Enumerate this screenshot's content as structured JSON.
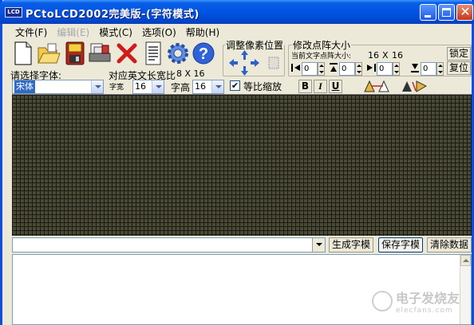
{
  "window": {
    "title": "PCtoLCD2002完美版-(字符模式)",
    "icon_text": "LCD"
  },
  "menu": [
    {
      "label": "文件(F)",
      "enabled": true
    },
    {
      "label": "编辑(E)",
      "enabled": false
    },
    {
      "label": "模式(C)",
      "enabled": true
    },
    {
      "label": "选项(O)",
      "enabled": true
    },
    {
      "label": "帮助(H)",
      "enabled": true
    }
  ],
  "toolbar": {
    "icons": [
      "new-icon",
      "open-icon",
      "save-icon",
      "print-icon",
      "delete-icon",
      "document-icon",
      "settings-gear-icon",
      "help-icon"
    ]
  },
  "adjust_group": {
    "title": "调整像素位置"
  },
  "resize_group": {
    "title": "修改点阵大小",
    "current_size_label": "当前文字点阵大小:",
    "width": "16",
    "x": "X",
    "height": "16",
    "lock_button": "锁定",
    "restore_button": "复位",
    "spinners": [
      "0",
      "0",
      "0",
      "0"
    ]
  },
  "font_row": {
    "choose_font_label": "请选择字体:",
    "font_value": "宋体",
    "ratio_label": "对应英文长宽比",
    "ratio_value": "8 X 16",
    "width_label": "字宽",
    "width_value": "16",
    "height_label": "字高",
    "height_value": "16",
    "proportional_label": "等比缩放",
    "proportional_checked": true,
    "bold": "B",
    "italic": "I",
    "underline": "U"
  },
  "actions": {
    "generate": "生成字模",
    "save": "保存字模",
    "clear": "清除数据"
  },
  "watermark": {
    "text": "电子发烧友",
    "sub": "elecfans.com"
  },
  "colors": {
    "titlebar": "#0054e3",
    "grid_cell": "#4a4a36",
    "grid_line": "#1b1b13",
    "window_bg": "#ece9d8"
  }
}
